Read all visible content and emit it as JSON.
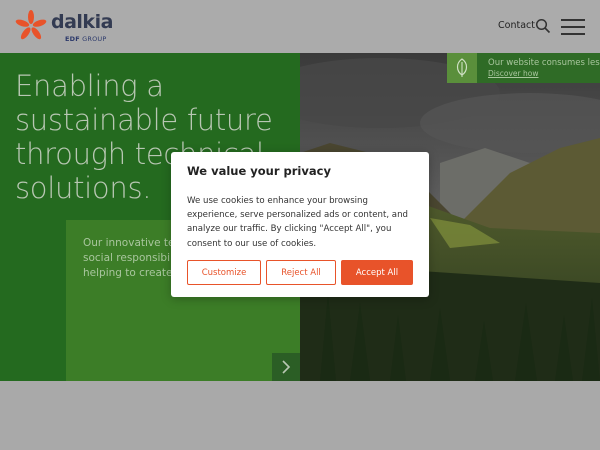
{
  "brand": {
    "name": "dalkia",
    "group_prefix": "EDF",
    "group_suffix": " GROUP",
    "colors": {
      "orange": "#e8532a",
      "navy": "#333b52",
      "green_dark": "#246a1f",
      "green_light": "#3c7d27"
    }
  },
  "header": {
    "contact_label": "Contact",
    "search_icon": "search-icon",
    "menu_icon": "hamburger-menu-icon"
  },
  "hero": {
    "title": "Enabling a sustainable future through technical solutions.",
    "card_text": "Our innovative tec\nsocial responsibili\nhelping to create a",
    "arrow_icon": "chevron-right-icon"
  },
  "eco_banner": {
    "text": "Our website consumes less",
    "link": "Discover how",
    "icon": "leaf-icon"
  },
  "cookie_modal": {
    "title": "We value your privacy",
    "body": "We use cookies to enhance your browsing experience, serve personalized ads or content, and analyze our traffic. By clicking \"Accept All\", you consent to our use of cookies.",
    "buttons": {
      "customize": "Customize",
      "reject": "Reject All",
      "accept": "Accept All"
    }
  }
}
